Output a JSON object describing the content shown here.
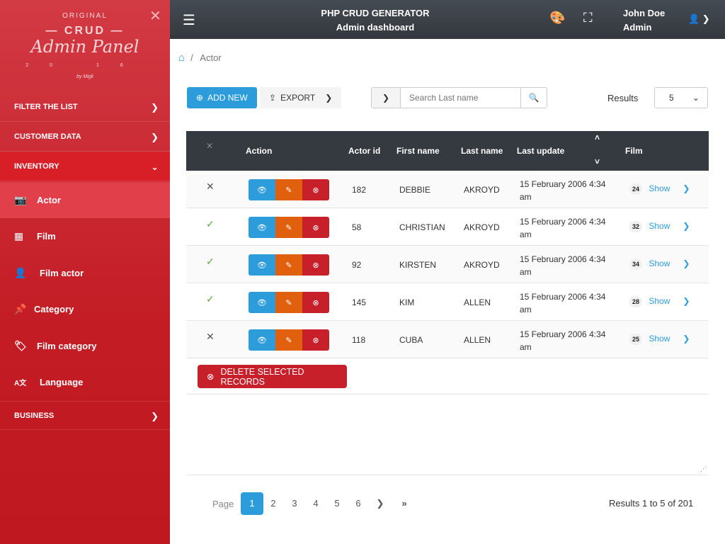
{
  "logo": {
    "top": "ORIGINAL",
    "crud": "— CRUD —",
    "main": "Admin Panel",
    "year": "20 16",
    "by": "by Migli"
  },
  "sidebar": {
    "sections": [
      {
        "label": "FILTER THE LIST"
      },
      {
        "label": "CUSTOMER DATA"
      },
      {
        "label": "INVENTORY"
      },
      {
        "label": "BUSINESS"
      }
    ],
    "items": [
      {
        "label": "Actor",
        "icon": "camera-icon"
      },
      {
        "label": "Film",
        "icon": "film-icon"
      },
      {
        "label": "Film actor",
        "icon": "user-tag-icon"
      },
      {
        "label": "Category",
        "icon": "thumbtack-icon"
      },
      {
        "label": "Film category",
        "icon": "tags-icon"
      },
      {
        "label": "Language",
        "icon": "language-icon"
      }
    ]
  },
  "topbar": {
    "title": "PHP CRUD GENERATOR",
    "subtitle": "Admin dashboard",
    "user_name": "John Doe",
    "user_role": "Admin"
  },
  "breadcrumb": {
    "current": "Actor"
  },
  "toolbar": {
    "add_new": "ADD NEW",
    "export": "EXPORT",
    "search_placeholder": "Search Last name",
    "results_label": "Results",
    "results_value": "5"
  },
  "table": {
    "headers": [
      "Action",
      "Actor id",
      "First name",
      "Last name",
      "Last update",
      "Film"
    ],
    "show_label": "Show",
    "rows": [
      {
        "selected": "✕",
        "id": "182",
        "first": "DEBBIE",
        "last": "AKROYD",
        "update": "15 February 2006 4:34 am",
        "films": "24"
      },
      {
        "selected": "✓",
        "id": "58",
        "first": "CHRISTIAN",
        "last": "AKROYD",
        "update": "15 February 2006 4:34 am",
        "films": "32"
      },
      {
        "selected": "✓",
        "id": "92",
        "first": "KIRSTEN",
        "last": "AKROYD",
        "update": "15 February 2006 4:34 am",
        "films": "34"
      },
      {
        "selected": "✓",
        "id": "145",
        "first": "KIM",
        "last": "ALLEN",
        "update": "15 February 2006 4:34 am",
        "films": "28"
      },
      {
        "selected": "✕",
        "id": "118",
        "first": "CUBA",
        "last": "ALLEN",
        "update": "15 February 2006 4:34 am",
        "films": "25"
      }
    ],
    "delete_selected": "DELETE SELECTED RECORDS"
  },
  "pagination": {
    "label": "Page",
    "pages": [
      "1",
      "2",
      "3",
      "4",
      "5",
      "6"
    ],
    "current": "1",
    "summary": "Results 1 to 5 of 201"
  },
  "colors": {
    "primary": "#2d9cdb",
    "edit": "#e8650e",
    "danger": "#c8202a",
    "success": "#5aa832",
    "sidebar": "#c31c25",
    "topbar": "#343a40"
  }
}
